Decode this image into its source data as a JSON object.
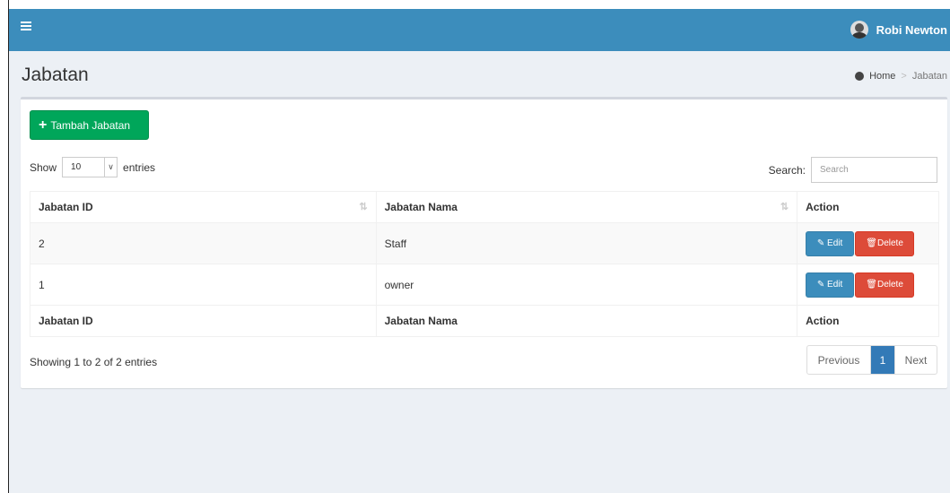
{
  "header": {
    "user_name": "Robi Newton"
  },
  "page": {
    "title": "Jabatan"
  },
  "breadcrumb": {
    "home": "Home",
    "current": "Jabatan"
  },
  "toolbar": {
    "add_label": "Tambah Jabatan"
  },
  "length_control": {
    "prefix": "Show",
    "value": "10",
    "suffix": "entries"
  },
  "search": {
    "label": "Search:",
    "placeholder": "Search"
  },
  "table": {
    "columns": [
      "Jabatan ID",
      "Jabatan Nama",
      "Action"
    ],
    "rows": [
      {
        "id": "2",
        "nama": "Staff"
      },
      {
        "id": "1",
        "nama": "owner"
      }
    ],
    "edit_label": "Edit",
    "delete_label": "Delete"
  },
  "footer": {
    "info": "Showing 1 to 2 of 2 entries"
  },
  "pagination": {
    "previous": "Previous",
    "current": "1",
    "next": "Next"
  },
  "colors": {
    "header": "#3c8dbc",
    "add": "#00a65a",
    "edit": "#3c8dbc",
    "delete": "#dd4b39",
    "active_page": "#337ab7"
  }
}
